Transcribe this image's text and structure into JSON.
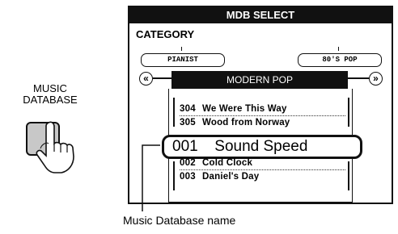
{
  "button": {
    "label_line1": "MUSIC",
    "label_line2": "DATABASE"
  },
  "display": {
    "title": "MDB SELECT",
    "category_label": "CATEGORY",
    "category_left": "PIANIST",
    "category_right": "80'S POP",
    "current_category": "MODERN POP",
    "list_above": [
      {
        "num": "304",
        "name": "We Were This Way"
      },
      {
        "num": "305",
        "name": "Wood from Norway"
      }
    ],
    "selected": {
      "num": "001",
      "name": "Sound Speed"
    },
    "list_below": [
      {
        "num": "002",
        "name": "Cold Clock"
      },
      {
        "num": "003",
        "name": "Daniel's Day"
      }
    ]
  },
  "caption": "Music Database name",
  "icons": [
    "hand-press-icon",
    "left-arrow-icon",
    "right-arrow-icon"
  ]
}
